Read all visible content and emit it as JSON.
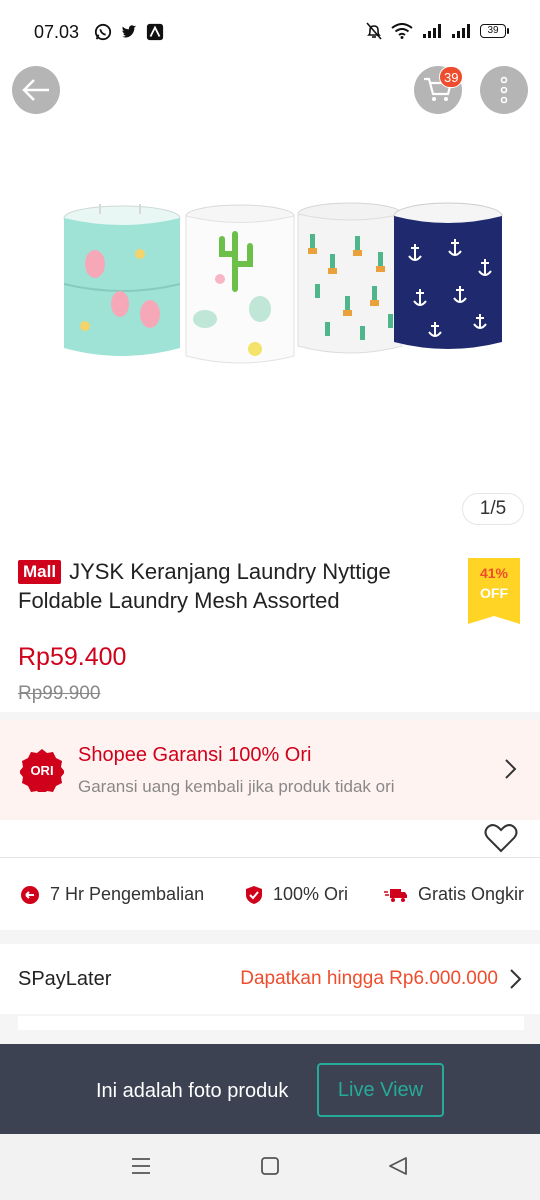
{
  "status_bar": {
    "time": "07.03",
    "left_icons": [
      "whatsapp-icon",
      "twitter-icon",
      "app-icon"
    ],
    "right_icons": [
      "mute-icon",
      "wifi-icon",
      "signal-icon",
      "signal-icon"
    ],
    "battery": "39"
  },
  "header": {
    "cart_count": "39"
  },
  "gallery": {
    "counter": "1/5"
  },
  "product": {
    "mall_badge": "Mall",
    "title": "JYSK Keranjang Laundry Nyttige Foldable Laundry Mesh Assorted",
    "discount_percent": "41%",
    "discount_label": "OFF",
    "price": "Rp59.400",
    "old_price": "Rp99.900"
  },
  "garansi": {
    "badge": "ORI",
    "title": "Shopee Garansi 100% Ori",
    "subtitle": "Garansi uang kembali jika produk tidak ori"
  },
  "features": [
    {
      "label": "7 Hr Pengembalian",
      "icon": "return-icon"
    },
    {
      "label": "100% Ori",
      "icon": "shield-check-icon"
    },
    {
      "label": "Gratis Ongkir",
      "icon": "truck-icon"
    }
  ],
  "spaylater": {
    "label": "SPayLater",
    "value": "Dapatkan hingga Rp6.000.000"
  },
  "live_bar": {
    "text": "Ini adalah foto produk",
    "button": "Live View"
  },
  "colors": {
    "brand": "#ee4d2d",
    "mall_red": "#d0011b",
    "teal": "#26aa99",
    "discount_yellow": "#ffd424"
  }
}
